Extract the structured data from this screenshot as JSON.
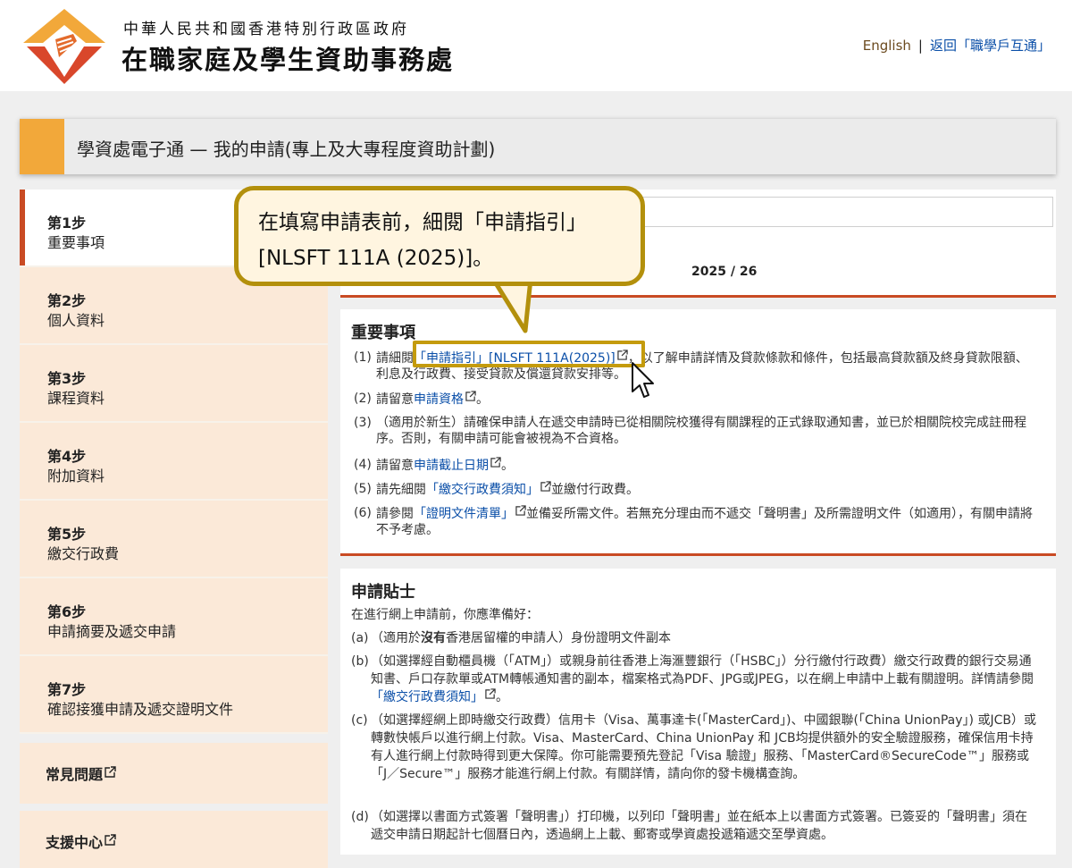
{
  "header": {
    "gov_name": "中華人民共和國香港特別行政區政府",
    "office_name": "在職家庭及學生資助事務處",
    "lang_link": "English",
    "separator": "|",
    "back_link": "返回「職學戶互通」"
  },
  "page_title": "學資處電子通 — 我的申請(專上及大專程度資助計劃)",
  "academic_year": "2025 / 26",
  "callout": "在填寫申請表前，細閱「申請指引」[NLSFT 111A (2025)]。",
  "sidebar": {
    "steps": [
      {
        "num": "第1步",
        "label": "重要事項"
      },
      {
        "num": "第2步",
        "label": "個人資料"
      },
      {
        "num": "第3步",
        "label": "課程資料"
      },
      {
        "num": "第4步",
        "label": "附加資料"
      },
      {
        "num": "第5步",
        "label": "繳交行政費"
      },
      {
        "num": "第6步",
        "label": "申請摘要及遞交申請"
      },
      {
        "num": "第7步",
        "label": "確認接獲申請及遞交證明文件"
      }
    ],
    "links": [
      {
        "label": "常見問題"
      },
      {
        "label": "支援中心"
      }
    ]
  },
  "important": {
    "title": "重要事項",
    "items": [
      {
        "num": "(1)",
        "pre": "請細閱",
        "link": "「申請指引」[NLSFT 111A(2025)]",
        "post": "，以了解申請詳情及貸款條款和條件，包括最高貸款額及終身貸款限額、利息及行政費、接受貸款及償還貸款安排等。"
      },
      {
        "num": "(2)",
        "pre": "請留意",
        "link": "申請資格",
        "post": "。"
      },
      {
        "num": "(3)",
        "text": "（適用於新生）請確保申請人在遞交申請時已從相關院校獲得有關課程的正式錄取通知書，並已於相關院校完成註冊程序。否則，有關申請可能會被視為不合資格。"
      },
      {
        "num": "(4)",
        "pre": "請留意",
        "link": "申請截止日期",
        "post": "。"
      },
      {
        "num": "(5)",
        "pre": "請先細閱",
        "link": "「繳交行政費須知」",
        "post": "並繳付行政費。"
      },
      {
        "num": "(6)",
        "pre": "請參閱",
        "link": "「證明文件清單」",
        "post": "並備妥所需文件。若無充分理由而不遞交「聲明書」及所需證明文件（如適用），有關申請將不予考慮。"
      }
    ]
  },
  "tips": {
    "title": "申請貼士",
    "intro": "在進行網上申請前，你應準備好：",
    "items": [
      {
        "num": "(a)",
        "pre": "（適用於",
        "bold": "沒有",
        "post": "香港居留權的申請人）身份證明文件副本"
      },
      {
        "num": "(b)",
        "pre": "（如選擇經自動櫃員機（「ATM」）或親身前往香港上海滙豐銀行（「HSBC」）分行繳付行政費）繳交行政費的銀行交易通知書、戶口存款單或ATM轉帳通知書的副本，檔案格式為PDF、JPG或JPEG，以在網上申請中上載有關證明。詳情請參閱",
        "link": "「繳交行政費須知」",
        "post": "。"
      },
      {
        "num": "(c)",
        "text": "（如選擇經網上即時繳交行政費）信用卡（Visa、萬事達卡(「MasterCard」)、中國銀聯(「China UnionPay」) 或JCB）或轉數快帳戶以進行網上付款。Visa、MasterCard、China UnionPay 和 JCB均提供額外的安全驗證服務，確保信用卡持有人進行網上付款時得到更大保障。你可能需要預先登記「Visa 驗證」服務、「MasterCard®SecureCode™」服務或 「J／Secure™」服務才能進行網上付款。有關詳情，請向你的發卡機構查詢。"
      },
      {
        "num": "(d)",
        "text": "（如選擇以書面方式簽署「聲明書」）打印機，以列印「聲明書」並在紙本上以書面方式簽署。已簽妥的「聲明書」須在遞交申請日期起計七個曆日內，透過網上上載、郵寄或學資處投遞箱遞交至學資處。"
      }
    ]
  },
  "colors": {
    "accent_orange": "#f2a83a",
    "accent_red": "#c94b23",
    "sidebar_bg": "#fbe9d8",
    "link": "#0b4fa8",
    "callout_border": "#b3900c",
    "callout_bg": "#fff5e0"
  },
  "icons": [
    "logo-icon",
    "external-link-icon",
    "mouse-cursor-icon"
  ]
}
